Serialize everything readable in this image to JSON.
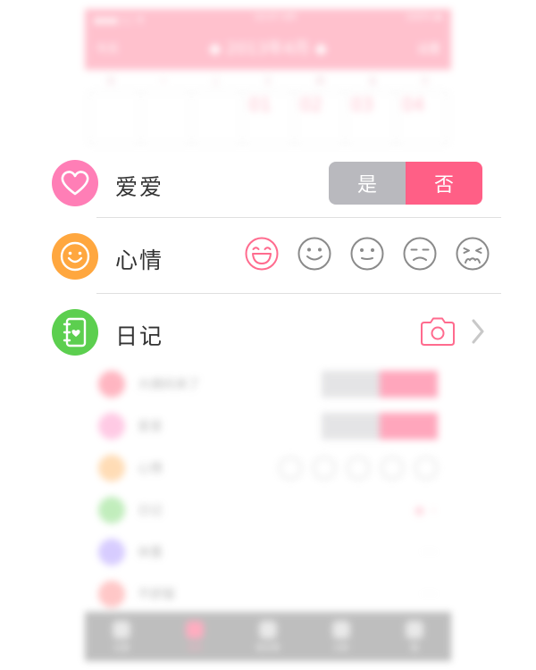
{
  "background_app": {
    "status_left": "●●●○○ 令",
    "status_time": "10:07 AM",
    "status_right": "100% ▬",
    "nav_left": "今天",
    "month_title": "◆ 2013年4月 ◆",
    "nav_right": "设置",
    "weekdays": [
      "日",
      "一",
      "二",
      "三",
      "四",
      "五",
      "六"
    ],
    "days": [
      "",
      "",
      "",
      "01",
      "02",
      "03",
      "04"
    ],
    "rows": [
      {
        "label": "大姨妈来了",
        "kind": "toggle"
      },
      {
        "label": "爱爱",
        "kind": "toggle"
      },
      {
        "label": "心情",
        "kind": "faces"
      },
      {
        "label": "日记",
        "kind": "camera"
      },
      {
        "label": "体重",
        "kind": "more"
      },
      {
        "label": "不舒服",
        "kind": "more"
      }
    ],
    "tabs": [
      "记录",
      "日历",
      "知识库",
      "分析",
      "我"
    ]
  },
  "panel": {
    "love": {
      "icon": "heart-icon",
      "icon_color": "#ff7eb6",
      "label": "爱爱",
      "yes_label": "是",
      "no_label": "否",
      "selected": "否",
      "yes_color": "#b9b9be",
      "no_color": "#ff5f86"
    },
    "mood": {
      "icon": "smiley-icon",
      "icon_color": "#ffa73f",
      "label": "心情",
      "faces": [
        "laughing-face-icon",
        "smile-face-icon",
        "neutral-face-icon",
        "unhappy-face-icon",
        "crying-face-icon"
      ],
      "selected_index": 0,
      "selected_color": "#ff6b8e",
      "unselected_color": "#8a8a8a"
    },
    "diary": {
      "icon": "notebook-icon",
      "icon_color": "#5ccf4f",
      "label": "日记",
      "camera_icon": "camera-icon",
      "chevron_icon": "chevron-right-icon"
    }
  }
}
